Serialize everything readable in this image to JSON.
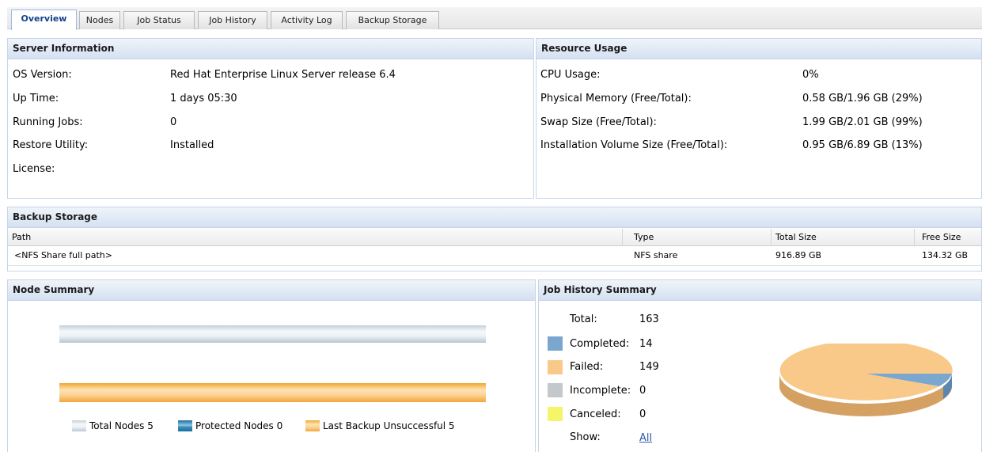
{
  "tabs": [
    {
      "label": "Overview",
      "active": true
    },
    {
      "label": "Nodes"
    },
    {
      "label": "Job Status"
    },
    {
      "label": "Job History"
    },
    {
      "label": "Activity Log"
    },
    {
      "label": "Backup Storage"
    }
  ],
  "server_info": {
    "title": "Server Information",
    "rows": [
      {
        "label": "OS Version:",
        "value": "Red Hat Enterprise Linux Server release 6.4"
      },
      {
        "label": "Up Time:",
        "value": "1 days 05:30"
      },
      {
        "label": "Running Jobs:",
        "value": "0"
      },
      {
        "label": "Restore Utility:",
        "value": "Installed"
      },
      {
        "label": "License:",
        "value": ""
      }
    ]
  },
  "resource_usage": {
    "title": "Resource Usage",
    "rows": [
      {
        "label": "CPU Usage:",
        "value": "0%"
      },
      {
        "label": "Physical Memory (Free/Total):",
        "value": "0.58 GB/1.96 GB (29%)"
      },
      {
        "label": "Swap Size (Free/Total):",
        "value": "1.99 GB/2.01 GB (99%)"
      },
      {
        "label": "Installation Volume Size (Free/Total):",
        "value": "0.95 GB/6.89 GB (13%)"
      }
    ]
  },
  "backup_storage": {
    "title": "Backup Storage",
    "columns": [
      "Path",
      "Type",
      "Total Size",
      "Free Size"
    ],
    "rows": [
      {
        "path": "<NFS Share full path>",
        "type": "NFS share",
        "total": "916.89 GB",
        "free": "134.32 GB"
      }
    ]
  },
  "node_summary": {
    "title": "Node Summary",
    "legend": [
      {
        "label": "Total Nodes 5",
        "color": "#d8e2ea"
      },
      {
        "label": "Protected Nodes 0",
        "color": "#3a8fc0"
      },
      {
        "label": "Last Backup Unsuccessful 5",
        "color": "#f7c27a"
      }
    ]
  },
  "job_history": {
    "title": "Job History Summary",
    "total_label": "Total:",
    "total_value": "163",
    "items": [
      {
        "label": "Completed:",
        "value": "14",
        "color": "#7ba7cf"
      },
      {
        "label": "Failed:",
        "value": "149",
        "color": "#f9c98a"
      },
      {
        "label": "Incomplete:",
        "value": "0",
        "color": "#c3c8cd"
      },
      {
        "label": "Canceled:",
        "value": "0",
        "color": "#f5f56a"
      }
    ],
    "show_label": "Show:",
    "show_link": "All"
  }
}
